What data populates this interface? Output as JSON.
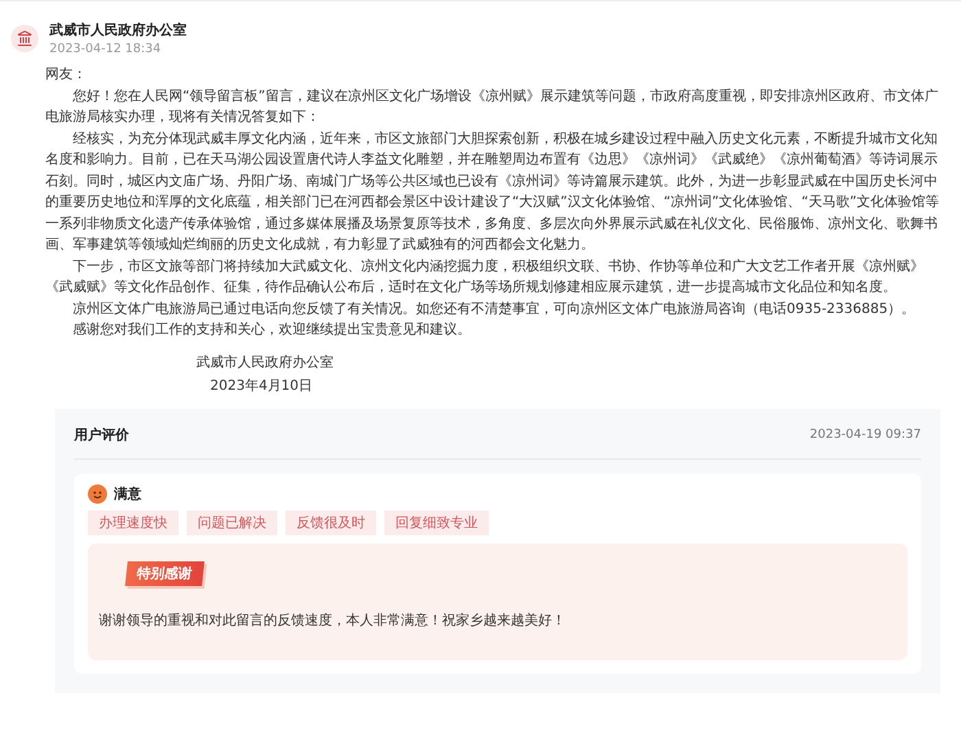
{
  "reply": {
    "author": "武威市人民政府办公室",
    "time": "2023-04-12 18:34"
  },
  "letter": {
    "salutation": "网友：",
    "paragraphs": [
      "您好！您在人民网“领导留言板”留言，建议在凉州区文化广场增设《凉州赋》展示建筑等问题，市政府高度重视，即安排凉州区政府、市文体广电旅游局核实办理，现将有关情况答复如下：",
      "经核实，为充分体现武威丰厚文化内涵，近年来，市区文旅部门大胆探索创新，积极在城乡建设过程中融入历史文化元素，不断提升城市文化知名度和影响力。目前，已在天马湖公园设置唐代诗人李益文化雕塑，并在雕塑周边布置有《边思》《凉州词》《武威绝》《凉州葡萄酒》等诗词展示石刻。同时，城区内文庙广场、丹阳广场、南城门广场等公共区域也已设有《凉州词》等诗篇展示建筑。此外，为进一步彰显武威在中国历史长河中的重要历史地位和浑厚的文化底蕴，相关部门已在河西都会景区中设计建设了“大汉赋”汉文化体验馆、“凉州词”文化体验馆、“天马歌”文化体验馆等一系列非物质文化遗产传承体验馆，通过多媒体展播及场景复原等技术，多角度、多层次向外界展示武威在礼仪文化、民俗服饰、凉州文化、歌舞书画、军事建筑等领域灿烂绚丽的历史文化成就，有力彰显了武威独有的河西都会文化魅力。",
      "下一步，市区文旅等部门将持续加大武威文化、凉州文化内涵挖掘力度，积极组织文联、书协、作协等单位和广大文艺工作者开展《凉州赋》《武威赋》等文化作品创作、征集，待作品确认公布后，适时在文化广场等场所规划修建相应展示建筑，进一步提高城市文化品位和知名度。",
      "凉州区文体广电旅游局已通过电话向您反馈了有关情况。如您还有不清楚事宜，可向凉州区文体广电旅游局咨询（电话0935-2336885）。",
      "感谢您对我们工作的支持和关心，欢迎继续提出宝贵意见和建议。"
    ],
    "signature": {
      "organization": "武威市人民政府办公室",
      "date": "2023年4月10日"
    }
  },
  "review": {
    "title": "用户评价",
    "time": "2023-04-19 09:37",
    "rating": "满意",
    "tags": [
      "办理速度快",
      "问题已解决",
      "反馈很及时",
      "回复细致专业"
    ],
    "badge": "特别感谢",
    "comment": "谢谢领导的重视和对此留言的反馈速度，本人非常满意！祝家乡越来越美好！"
  }
}
